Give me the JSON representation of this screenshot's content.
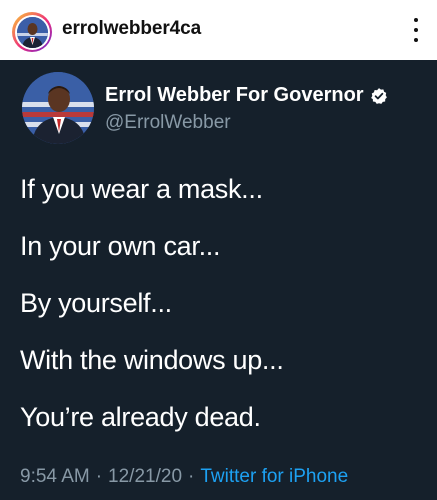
{
  "post": {
    "username": "errolwebber4ca",
    "more_icon": "more-vertical-icon"
  },
  "tweet": {
    "display_name": "Errol Webber For Governor",
    "handle": "@ErrolWebber",
    "verified_icon": "verified-badge-icon",
    "lines": [
      "If you wear a mask...",
      "In your own car...",
      "By yourself...",
      "With the windows up...",
      "You’re already dead."
    ],
    "time": "9:54 AM",
    "date": "12/21/20",
    "separator": "·",
    "source": "Twitter for iPhone"
  },
  "colors": {
    "tweet_background": "#15202b",
    "secondary_text": "#8899a6",
    "link": "#1da1f2"
  }
}
